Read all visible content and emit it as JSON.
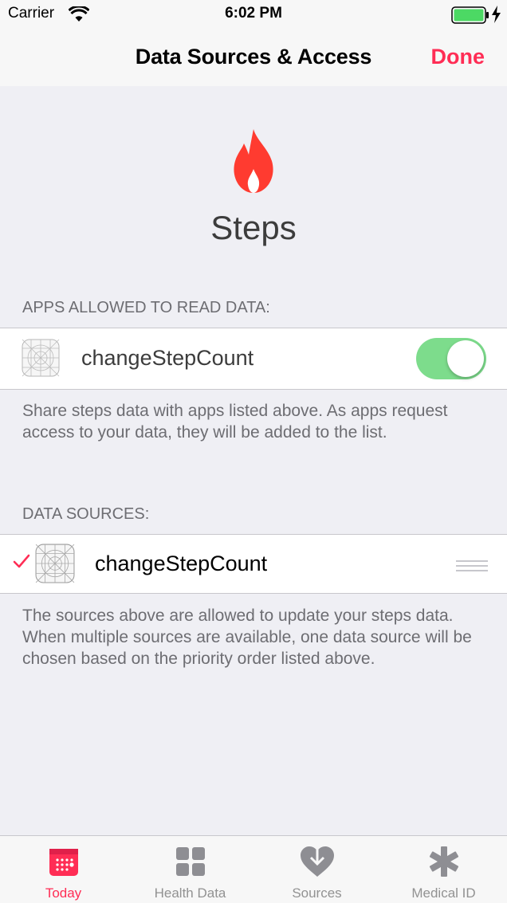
{
  "status_bar": {
    "carrier": "Carrier",
    "time": "6:02 PM",
    "battery_color": "#4cd964"
  },
  "nav": {
    "title": "Data Sources & Access",
    "done_label": "Done",
    "accent_color": "#ff2d55"
  },
  "header": {
    "icon": "flame-icon",
    "title": "Steps"
  },
  "read_section": {
    "header": "APPS ALLOWED TO READ DATA:",
    "apps": [
      {
        "name": "changeStepCount",
        "enabled": true
      }
    ],
    "footer": "Share steps data with apps listed above. As apps request access to your data, they will be added to the list."
  },
  "sources_section": {
    "header": "DATA SOURCES:",
    "sources": [
      {
        "name": "changeStepCount",
        "checked": true
      }
    ],
    "footer": "The sources above are allowed to update your steps data. When multiple sources are available, one data source will be chosen based on the priority order listed above."
  },
  "tabbar": {
    "tabs": [
      {
        "label": "Today",
        "icon": "calendar-icon",
        "active": true
      },
      {
        "label": "Health Data",
        "icon": "grid-icon",
        "active": false
      },
      {
        "label": "Sources",
        "icon": "heart-download-icon",
        "active": false
      },
      {
        "label": "Medical ID",
        "icon": "asterisk-icon",
        "active": false
      }
    ]
  }
}
